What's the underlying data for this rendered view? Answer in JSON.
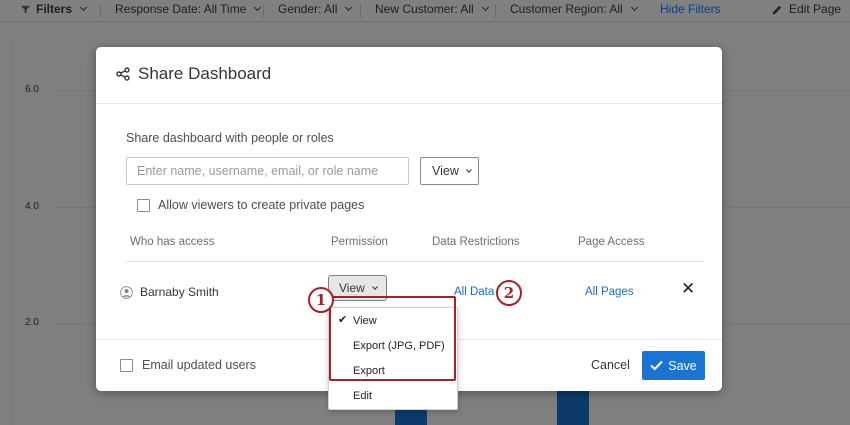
{
  "filter_bar": {
    "filters_label": "Filters",
    "response_date": "Response Date: All Time",
    "gender": "Gender: All",
    "new_customer": "New Customer: All",
    "customer_region": "Customer Region: All",
    "hide_filters": "Hide Filters",
    "edit_page": "Edit Page"
  },
  "chart_background": {
    "y_ticks": [
      "6.0",
      "4.0",
      "2.0"
    ]
  },
  "modal": {
    "title": "Share Dashboard",
    "share_label": "Share dashboard with people or roles",
    "search_placeholder": "Enter name, username, email, or role name",
    "permission_select_value": "View",
    "allow_private_pages_label": "Allow viewers to create private pages",
    "table": {
      "headers": {
        "who": "Who has access",
        "permission": "Permission",
        "data_restrictions": "Data Restrictions",
        "page_access": "Page Access"
      },
      "rows": [
        {
          "name": "Barnaby Smith",
          "permission": "View",
          "data_restrictions": "All Data",
          "page_access": "All Pages"
        }
      ]
    },
    "email_updated_users_label": "Email updated users",
    "cancel_label": "Cancel",
    "save_label": "Save"
  },
  "permission_dropdown": {
    "selected": "View",
    "options": [
      "View",
      "Export (JPG, PDF)",
      "Export",
      "Edit"
    ]
  },
  "annotations": {
    "badge_1": "1",
    "badge_2": "2",
    "color": "#a0222a"
  },
  "colors": {
    "accent": "#1a74d4",
    "link": "#1a6ad8",
    "overlay": "#7f7f80"
  },
  "icons": {
    "filter": "filter-icon",
    "edit": "pencil-icon",
    "share": "share-icon",
    "user": "user-avatar-icon",
    "close": "close-icon",
    "check": "checkmark-icon"
  }
}
